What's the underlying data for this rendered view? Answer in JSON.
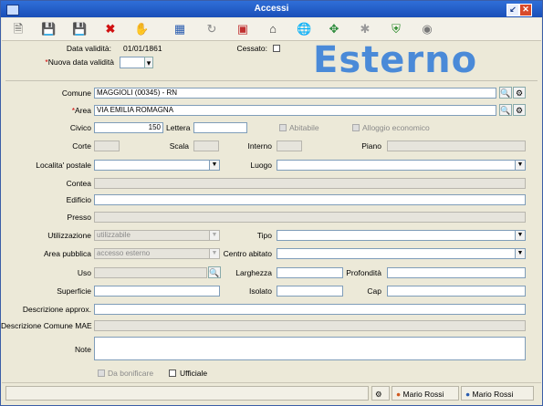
{
  "window": {
    "title": "Accessi"
  },
  "toolbar": {
    "icons": [
      "new-icon",
      "save-icon",
      "save-as-icon",
      "delete-icon",
      "handshake-icon",
      "calculator-icon",
      "refresh-icon",
      "book-icon",
      "home-icon",
      "globe-icon",
      "arrows-icon",
      "tool-icon",
      "shield-icon",
      "lamp-icon"
    ]
  },
  "header": {
    "data_validita_label": "Data validità:",
    "data_validita_value": "01/01/1861",
    "cessato_label": "Cessato:",
    "nuova_data_label": "Nuova data validità",
    "nuova_data_value": "",
    "badge": "Esterno"
  },
  "form": {
    "comune_label": "Comune",
    "comune_value": "MAGGIOLI (00345) - RN",
    "area_label": "Area",
    "area_value": "VIA EMILIA ROMAGNA",
    "civico_label": "Civico",
    "civico_value": "150",
    "lettera_label": "Lettera",
    "lettera_value": "",
    "abitabile_label": "Abitabile",
    "alloggio_label": "Alloggio economico",
    "corte_label": "Corte",
    "scala_label": "Scala",
    "interno_label": "Interno",
    "piano_label": "Piano",
    "localita_label": "Localita' postale",
    "localita_value": "",
    "luogo_label": "Luogo",
    "luogo_value": "",
    "contea_label": "Contea",
    "edificio_label": "Edificio",
    "presso_label": "Presso",
    "utilizzazione_label": "Utilizzazione",
    "utilizzazione_value": "utilizzabile",
    "tipo_label": "Tipo",
    "tipo_value": "",
    "area_pubblica_label": "Area pubblica",
    "area_pubblica_value": "accesso esterno",
    "centro_abitato_label": "Centro abitato",
    "centro_abitato_value": "",
    "uso_label": "Uso",
    "larghezza_label": "Larghezza",
    "profondita_label": "Profondità",
    "superficie_label": "Superficie",
    "isolato_label": "Isolato",
    "cap_label": "Cap",
    "descrizione_approx_label": "Descrizione approx.",
    "descrizione_mae_label": "Descrizione Comune MAE",
    "note_label": "Note",
    "da_bonificare_label": "Da bonificare",
    "ufficiale_label": "Ufficiale"
  },
  "statusbar": {
    "user1": "Mario Rossi",
    "user2": "Mario Rossi"
  }
}
